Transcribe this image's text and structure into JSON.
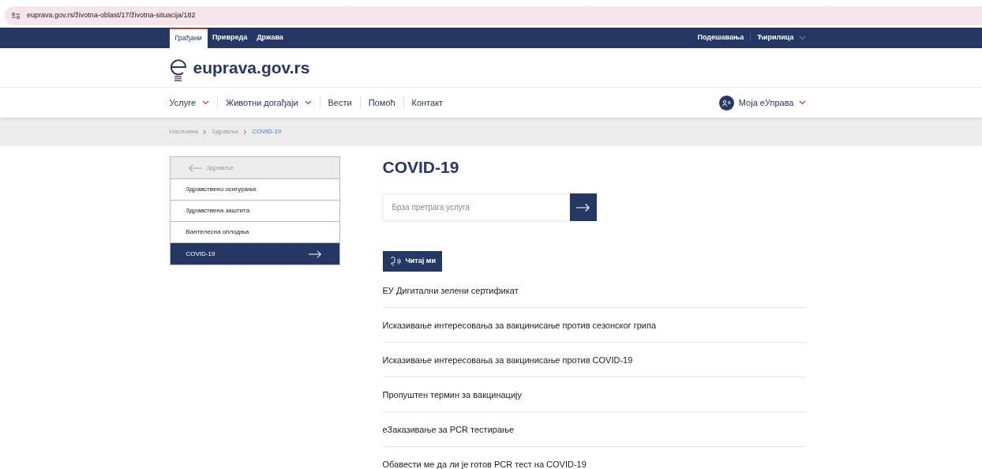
{
  "address_bar": {
    "url": "euprava.gov.rs/životna-oblast/17/životna-situacija/182"
  },
  "top_bar": {
    "tabs": [
      {
        "label": "Грађани",
        "selected": true
      },
      {
        "label": "Привреда",
        "selected": false
      },
      {
        "label": "Држава",
        "selected": false
      }
    ],
    "settings": "Подешавања",
    "language": "Ћирилица"
  },
  "logo": {
    "text": "euprava.gov.rs"
  },
  "menu": {
    "items": [
      {
        "label": "Услуге",
        "dropdown": true
      },
      {
        "label": "Животни догађаји",
        "dropdown": true
      },
      {
        "label": "Вести",
        "dropdown": false
      },
      {
        "label": "Помоћ",
        "dropdown": false
      },
      {
        "label": "Контакт",
        "dropdown": false
      }
    ],
    "account": "Моја еУправа"
  },
  "breadcrumb": [
    {
      "label": "Насловна",
      "current": false
    },
    {
      "label": "Здравље",
      "current": false
    },
    {
      "label": "COVID-19",
      "current": true
    }
  ],
  "sidebar": {
    "back": "Здравље",
    "items": [
      {
        "label": "Здравствено осигурање",
        "selected": false
      },
      {
        "label": "Здравствена заштита",
        "selected": false
      },
      {
        "label": "Вантелесна оплодња",
        "selected": false
      },
      {
        "label": "COVID-19",
        "selected": true
      }
    ]
  },
  "main": {
    "title": "COVID-19",
    "search": {
      "placeholder": "Брза претрага услуга"
    },
    "read_button": "Читај ми",
    "links": [
      "ЕУ Дигитални зелени сертификат",
      "Исказивање интересовања за вакцинисање против сезонског грипа",
      "Исказивање интересовања за вакцинисање против COVID-19",
      "Пропуштен термин за вакцинацију",
      "еЗаказивање за PCR тестирање",
      "Обавести ме да ли је готов PCR тест на COVID-19"
    ]
  }
}
